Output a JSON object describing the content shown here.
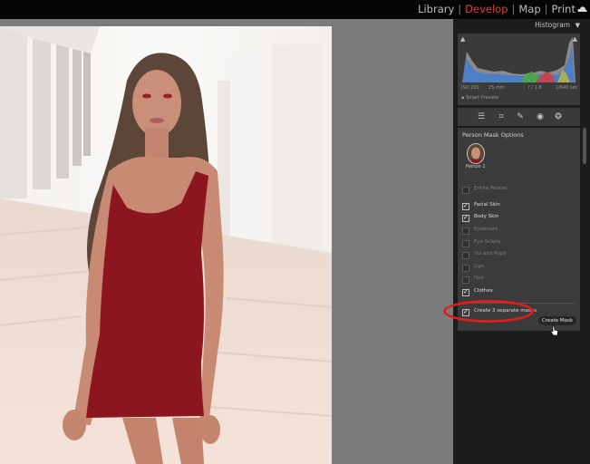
{
  "modules": [
    "Library",
    "Develop",
    "Map",
    "Print"
  ],
  "active_module": "Develop",
  "histogram": {
    "title": "Histogram",
    "exif": [
      "ISO 200",
      "25 mm",
      "f / 1.8",
      "1/640 sec"
    ],
    "smart_preview": "Smart Preview"
  },
  "tools": [
    "sliders-icon",
    "crop-icon",
    "healing-icon",
    "red-eye-icon",
    "masking-icon"
  ],
  "mask_panel": {
    "title": "Person Mask Options",
    "person_label": "Person 1",
    "options": [
      {
        "label": "Entire Person",
        "checked": false
      },
      {
        "label": "Facial Skin",
        "checked": true
      },
      {
        "label": "Body Skin",
        "checked": true
      },
      {
        "label": "Eyebrows",
        "checked": false
      },
      {
        "label": "Eye Sclera",
        "checked": false
      },
      {
        "label": "Iris and Pupil",
        "checked": false
      },
      {
        "label": "Lips",
        "checked": false
      },
      {
        "label": "Hair",
        "checked": false
      },
      {
        "label": "Clothes",
        "checked": true
      },
      {
        "label": "Create 3 separate masks",
        "checked": true
      }
    ],
    "create_button": "Create Mask"
  },
  "colors": {
    "active_module": "#e2403a",
    "annotation": "#e01f17",
    "mask_overlay": "#a01020"
  }
}
